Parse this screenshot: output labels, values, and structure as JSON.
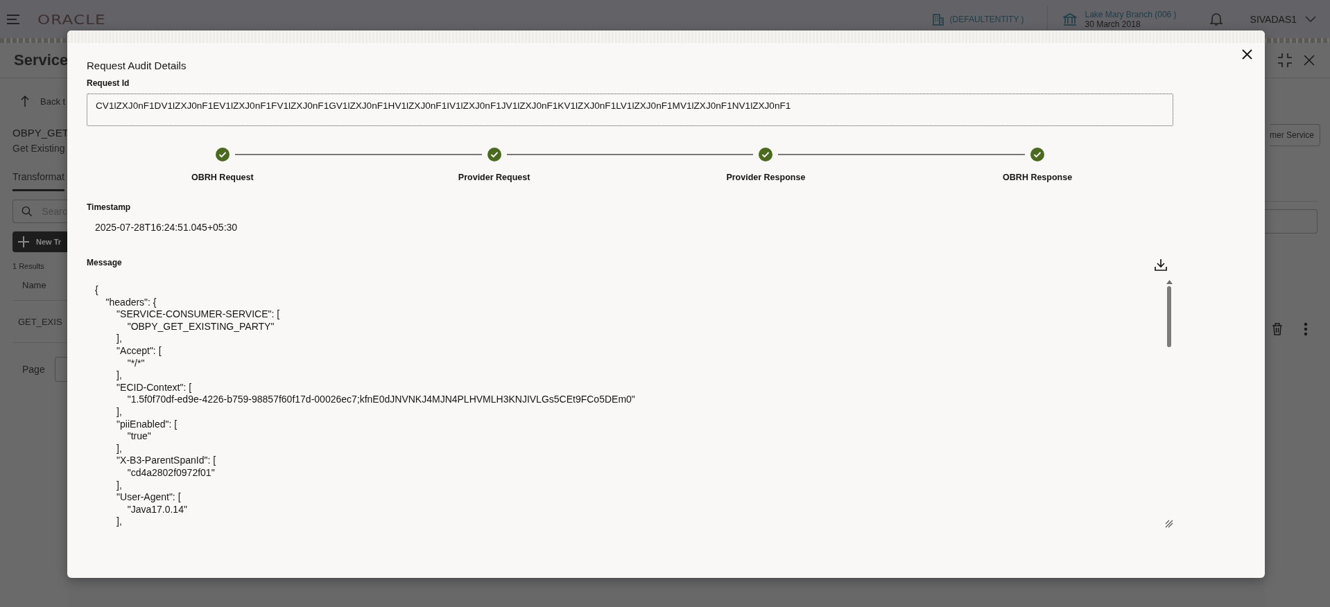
{
  "header": {
    "logo": "ORACLE",
    "entity": "(DEFAULTENTITY )",
    "branch": "Lake Mary Branch (006 )",
    "date": "30 March 2018",
    "user": "SIVADAS1"
  },
  "background_page": {
    "title": "Service",
    "back_link": "Back t",
    "service_name": "OBPY_GET",
    "service_desc": "Get Existing",
    "tab": {
      "label": "Transformat",
      "selected": true
    },
    "search": {
      "placeholder": "Searc"
    },
    "new_button": "New Tr",
    "results": "1 Results",
    "column": "Name",
    "row_name": "GET_EXIS",
    "page_label": "Page",
    "right_button": "mer Service"
  },
  "dialog": {
    "title": "Request Audit Details",
    "request_id_label": "Request Id",
    "request_id": "CV1lZXJ0nF1DV1lZXJ0nF1EV1lZXJ0nF1FV1lZXJ0nF1GV1lZXJ0nF1HV1lZXJ0nF1IV1lZXJ0nF1JV1lZXJ0nF1KV1lZXJ0nF1LV1lZXJ0nF1MV1lZXJ0nF1NV1lZXJ0nF1",
    "steps": [
      {
        "label": "OBRH Request",
        "completed": true
      },
      {
        "label": "Provider Request",
        "completed": true
      },
      {
        "label": "Provider Response",
        "completed": true
      },
      {
        "label": "OBRH Response",
        "completed": true
      }
    ],
    "timestamp_label": "Timestamp",
    "timestamp": "2025-07-28T16:24:51.045+05:30",
    "message_label": "Message",
    "message": "{\n    \"headers\": {\n        \"SERVICE-CONSUMER-SERVICE\": [\n            \"OBPY_GET_EXISTING_PARTY\"\n        ],\n        \"Accept\": [\n            \"*/*\"\n        ],\n        \"ECID-Context\": [\n            \"1.5f0f70df-ed9e-4226-b759-98857f60f17d-00026ec7;kfnE0dJNVNKJ4MJN4PLHVMLH3KNJIVLGs5CEt9FCo5DEm0\"\n        ],\n        \"piiEnabled\": [\n            \"true\"\n        ],\n        \"X-B3-ParentSpanId\": [\n            \"cd4a2802f0972f01\"\n        ],\n        \"User-Agent\": [\n            \"Java17.0.14\"\n        ],"
  }
}
